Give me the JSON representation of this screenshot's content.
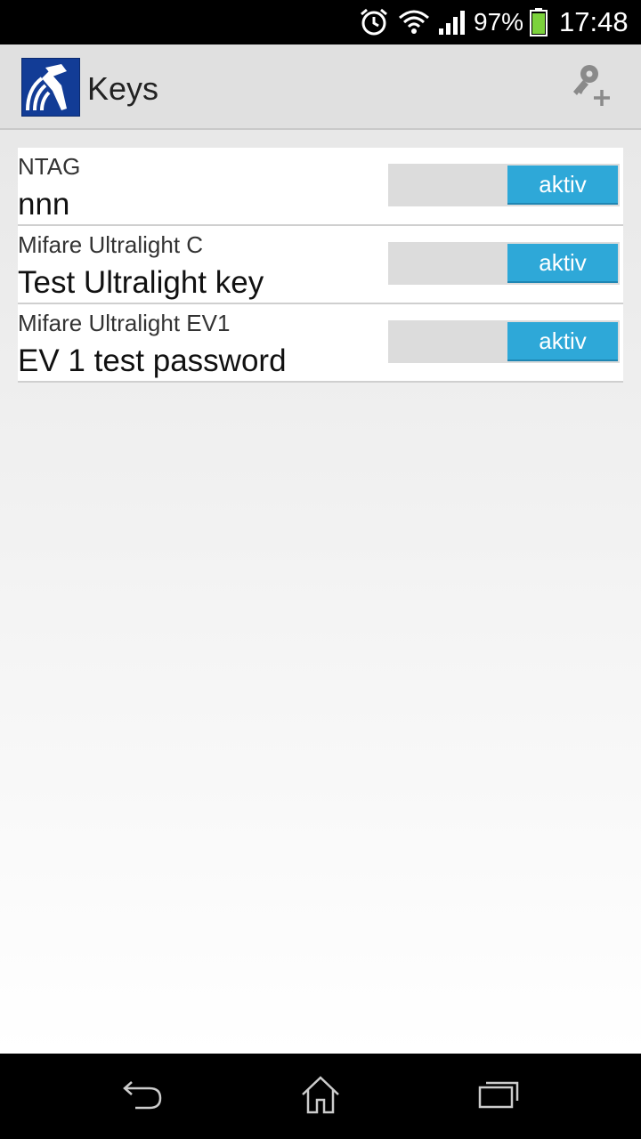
{
  "status_bar": {
    "battery_percent": "97%",
    "time": "17:48",
    "icons": [
      "alarm-icon",
      "wifi-icon",
      "signal-icon",
      "battery-icon"
    ]
  },
  "app_bar": {
    "title": "Keys",
    "logo_icon": "nfc-tools-logo-icon",
    "action_icon": "add-key-icon"
  },
  "keys": [
    {
      "type": "NTAG",
      "name": "nnn",
      "toggle_label": "aktiv"
    },
    {
      "type": "Mifare Ultralight C",
      "name": "Test Ultralight key",
      "toggle_label": "aktiv"
    },
    {
      "type": "Mifare Ultralight EV1",
      "name": "EV 1 test password",
      "toggle_label": "aktiv"
    }
  ],
  "nav_bar": {
    "icons": [
      "back-icon",
      "home-icon",
      "recent-apps-icon"
    ]
  },
  "colors": {
    "toggle_on": "#2ea8d8",
    "app_bar_bg": "#e0e0e0",
    "logo_bg": "#123c96"
  }
}
